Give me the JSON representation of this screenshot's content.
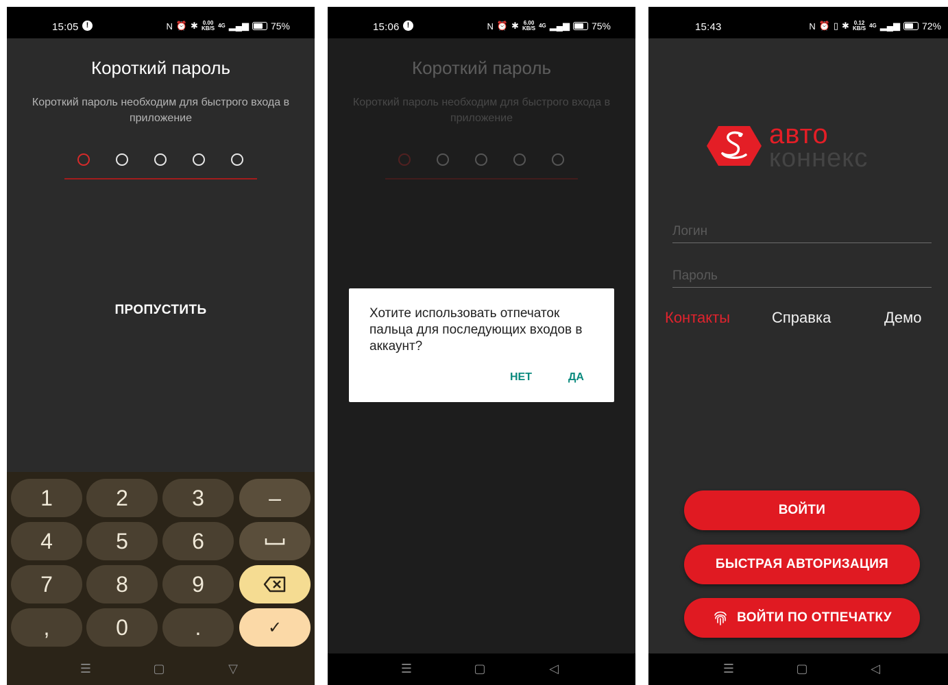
{
  "screen1": {
    "status": {
      "time": "15:05",
      "info_dot": "!",
      "net_speed_top": "0.00",
      "net_speed_bottom": "KB/S",
      "network": "4G",
      "battery": "75%"
    },
    "title": "Короткий пароль",
    "subtitle": "Короткий пароль необходим для быстрого входа в приложение",
    "pin_length": 5,
    "pin_entered": 0,
    "skip_label": "ПРОПУСТИТЬ",
    "keyboard": {
      "k1": "1",
      "k2": "2",
      "k3": "3",
      "minus": "–",
      "k4": "4",
      "k5": "5",
      "k6": "6",
      "space": "␣",
      "k7": "7",
      "k8": "8",
      "k9": "9",
      "backspace": "⌫",
      "comma": ",",
      "k0": "0",
      "dot": ".",
      "done": "✓"
    },
    "nav": {
      "menu": "☰",
      "home": "▢",
      "back": "▽"
    }
  },
  "screen2": {
    "status": {
      "time": "15:06",
      "info_dot": "!",
      "net_speed_top": "6.00",
      "net_speed_bottom": "KB/S",
      "network": "4G",
      "battery": "75%"
    },
    "title": "Короткий пароль",
    "subtitle": "Короткий пароль необходим для быстрого входа в приложение",
    "dialog": {
      "message": "Хотите использовать отпечаток пальца для последующих входов в аккаунт?",
      "no": "НЕТ",
      "yes": "ДА"
    },
    "nav": {
      "menu": "☰",
      "home": "▢",
      "back": "◁"
    }
  },
  "screen3": {
    "status": {
      "time": "15:43",
      "net_speed_top": "0.12",
      "net_speed_bottom": "KB/S",
      "network": "4G",
      "battery": "72%"
    },
    "logo": {
      "word1": "авто",
      "word2": "коннекс"
    },
    "login_placeholder": "Логин",
    "password_placeholder": "Пароль",
    "links": {
      "contacts": "Контакты",
      "help": "Справка",
      "demo": "Демо"
    },
    "buttons": {
      "login": "ВОЙТИ",
      "quick_auth": "БЫСТРАЯ АВТОРИЗАЦИЯ",
      "fingerprint": "ВОЙТИ ПО ОТПЕЧАТКУ"
    },
    "nav": {
      "menu": "☰",
      "home": "▢",
      "back": "◁"
    }
  },
  "colors": {
    "accent_red": "#e01a22",
    "dialog_button": "#0a8a7e",
    "keyboard_bg": "#2b2418"
  }
}
